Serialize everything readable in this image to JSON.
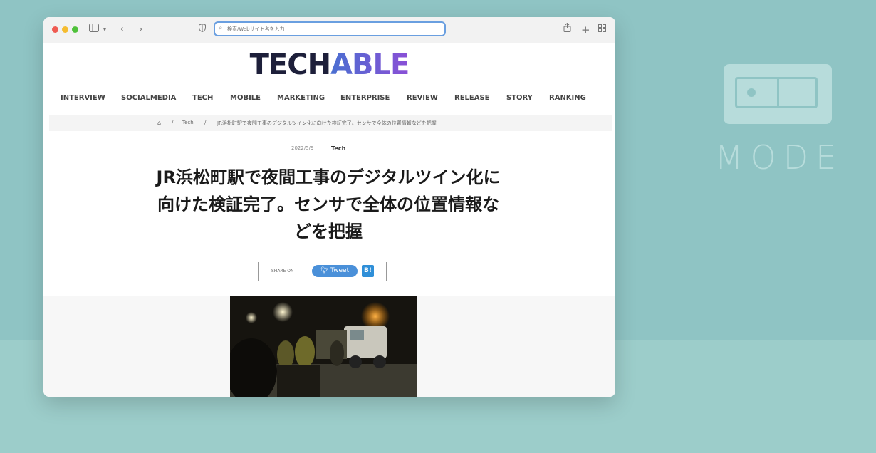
{
  "overlay": {
    "brand": "MODE"
  },
  "browser": {
    "address_placeholder": "検索/Webサイト名を入力"
  },
  "site": {
    "logo_part1": "TECH",
    "logo_part2": "ABLE",
    "nav": [
      "INTERVIEW",
      "SOCIALMEDIA",
      "TECH",
      "MOBILE",
      "MARKETING",
      "ENTERPRISE",
      "REVIEW",
      "RELEASE",
      "STORY",
      "RANKING"
    ]
  },
  "breadcrumb": {
    "sep": "/",
    "category": "Tech",
    "current": "JR浜松町駅で夜間工事のデジタルツイン化に向けた検証完了。センサで全体の位置情報などを把握"
  },
  "article": {
    "date": "2022/5/9",
    "category": "Tech",
    "title_lines": [
      "JR浜松町駅で夜間工事のデジタルツイン化に",
      "向けた検証完了。センサで全体の位置情報な",
      "どを把握"
    ]
  },
  "share": {
    "count_label": "SHARE ON",
    "tweet_label": "Tweet",
    "hatena_label": "B!"
  },
  "colors": {
    "background": "#8fc4c4",
    "logo_dark": "#1d1f3a",
    "logo_gradient_start": "#4a6fd1",
    "logo_gradient_end": "#8a4fd6",
    "tweet": "#4a90d9"
  }
}
